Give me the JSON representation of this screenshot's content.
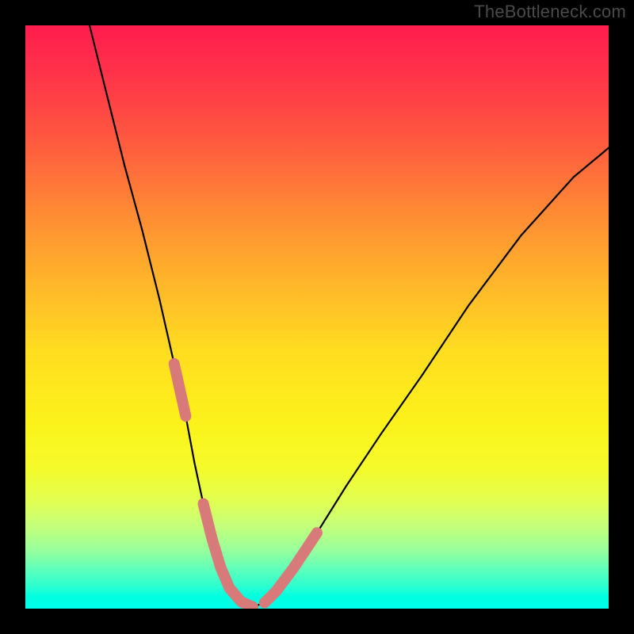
{
  "watermark": "TheBottleneck.com",
  "chart_data": {
    "type": "line",
    "title": "",
    "xlabel": "",
    "ylabel": "",
    "xlim": [
      0,
      100
    ],
    "ylim": [
      0,
      100
    ],
    "grid": false,
    "series": [
      {
        "name": "bottleneck-curve",
        "x_pct": [
          11.0,
          14.0,
          17.0,
          20.0,
          23.0,
          25.5,
          27.5,
          29.0,
          30.5,
          32.0,
          33.5,
          35.0,
          37.0,
          39.0,
          41.0,
          43.0,
          46.0,
          50.0,
          55.0,
          61.0,
          68.0,
          76.0,
          85.0,
          94.0,
          100.0
        ],
        "y_pct": [
          100.0,
          88.0,
          76.0,
          65.0,
          53.0,
          42.0,
          33.0,
          25.0,
          18.0,
          12.0,
          7.0,
          3.5,
          1.2,
          0.3,
          1.0,
          3.0,
          7.0,
          13.0,
          21.0,
          30.0,
          40.0,
          52.0,
          64.0,
          74.0,
          79.0
        ]
      }
    ],
    "marker_segments": [
      {
        "start_idx": 5,
        "end_idx": 6
      },
      {
        "start_idx": 8,
        "end_idx": 13
      },
      {
        "start_idx": 14,
        "end_idx": 17
      }
    ],
    "gradient_stops": [
      {
        "pct": 0,
        "color": "#ff1d4e"
      },
      {
        "pct": 8,
        "color": "#ff324a"
      },
      {
        "pct": 20,
        "color": "#ff5a3f"
      },
      {
        "pct": 32,
        "color": "#ff8a34"
      },
      {
        "pct": 44,
        "color": "#ffb52a"
      },
      {
        "pct": 56,
        "color": "#ffdd20"
      },
      {
        "pct": 68,
        "color": "#fcf21a"
      },
      {
        "pct": 76,
        "color": "#f4fb2a"
      },
      {
        "pct": 82,
        "color": "#dfff56"
      },
      {
        "pct": 86,
        "color": "#c3ff7d"
      },
      {
        "pct": 90,
        "color": "#97ff9c"
      },
      {
        "pct": 93,
        "color": "#63ffb8"
      },
      {
        "pct": 96,
        "color": "#2fffcf"
      },
      {
        "pct": 98,
        "color": "#00ffe0"
      },
      {
        "pct": 100,
        "color": "#00ffea"
      }
    ],
    "marker_color": "#d97a7a",
    "curve_color": "#000000"
  }
}
